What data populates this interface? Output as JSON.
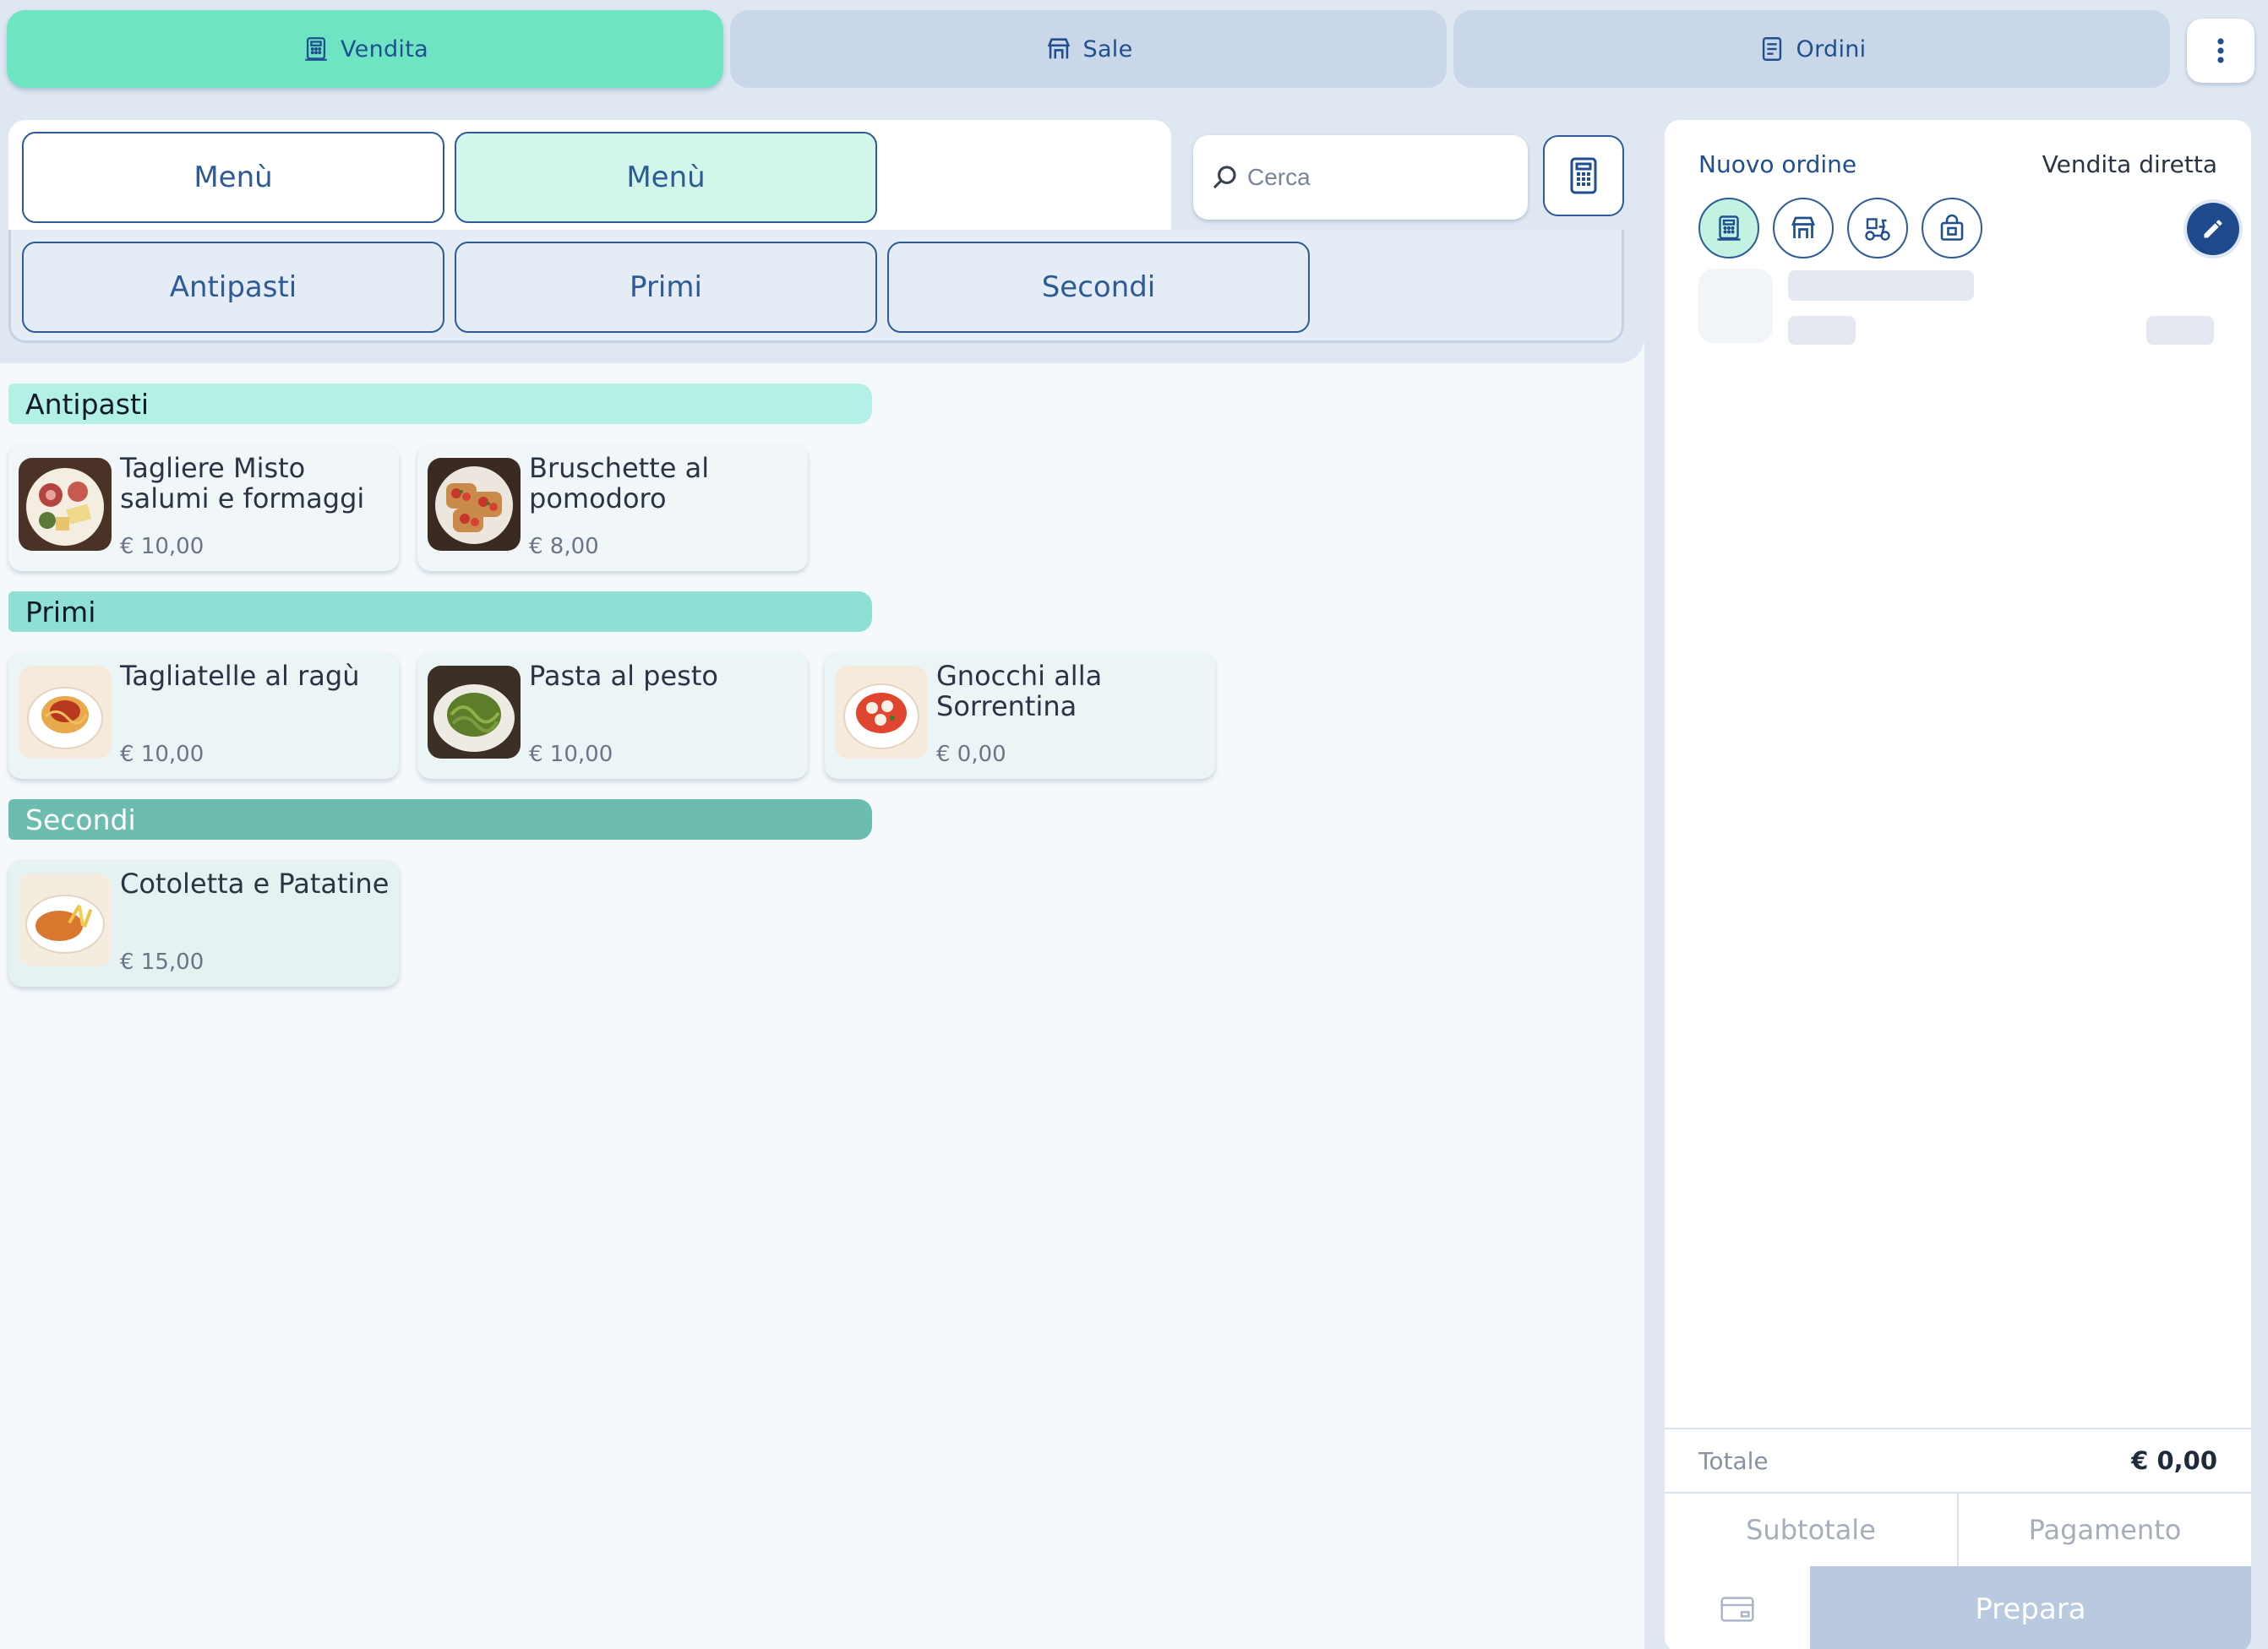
{
  "nav": {
    "tabs": [
      {
        "label": "Vendita",
        "icon": "register-icon",
        "active": true
      },
      {
        "label": "Sale",
        "icon": "store-icon",
        "active": false
      },
      {
        "label": "Ordini",
        "icon": "receipt-icon",
        "active": false
      }
    ],
    "more_icon": "kebab-menu-icon"
  },
  "menus": [
    {
      "label": "Menù",
      "selected": false
    },
    {
      "label": "Menù",
      "selected": true
    }
  ],
  "categories": [
    "Antipasti",
    "Primi",
    "Secondi"
  ],
  "search": {
    "placeholder": "Cerca",
    "value": ""
  },
  "sections": [
    {
      "title": "Antipasti",
      "color": "#b3f0e6",
      "tint": "#f1f6f8",
      "products": [
        {
          "name": "Tagliere Misto salumi e formaggi",
          "price": "€ 10,00",
          "thumb": "charcuterie-board"
        },
        {
          "name": "Bruschette al pomodoro",
          "price": "€ 8,00",
          "thumb": "bruschetta"
        }
      ]
    },
    {
      "title": "Primi",
      "color": "#8ee0d4",
      "tint": "#ecf5f6",
      "products": [
        {
          "name": "Tagliatelle al ragù",
          "price": "€ 10,00",
          "thumb": "tagliatelle"
        },
        {
          "name": "Pasta al pesto",
          "price": "€ 10,00",
          "thumb": "pesto-pasta"
        },
        {
          "name": "Gnocchi alla Sorrentina",
          "price": "€ 0,00",
          "thumb": "gnocchi"
        }
      ]
    },
    {
      "title": "Secondi",
      "color": "#6cbdb0",
      "tint": "#e6f1f1",
      "products": [
        {
          "name": "Cotoletta e Patatine",
          "price": "€ 15,00",
          "thumb": "cutlet-fries"
        }
      ]
    }
  ],
  "order": {
    "title": "Nuovo ordine",
    "type_label": "Vendita diretta",
    "type_buttons": [
      {
        "icon": "register-icon",
        "active": true
      },
      {
        "icon": "table-icon",
        "active": false
      },
      {
        "icon": "scooter-icon",
        "active": false
      },
      {
        "icon": "takeaway-bag-icon",
        "active": false
      }
    ],
    "total_label": "Totale",
    "total_value": "€ 0,00",
    "subtotal_label": "Subtotale",
    "payment_label": "Pagamento",
    "prepare_label": "Prepara"
  },
  "colors": {
    "accent": "#6fe4c3",
    "primary": "#1f4f8f",
    "disabled": "#b8c9e0"
  }
}
